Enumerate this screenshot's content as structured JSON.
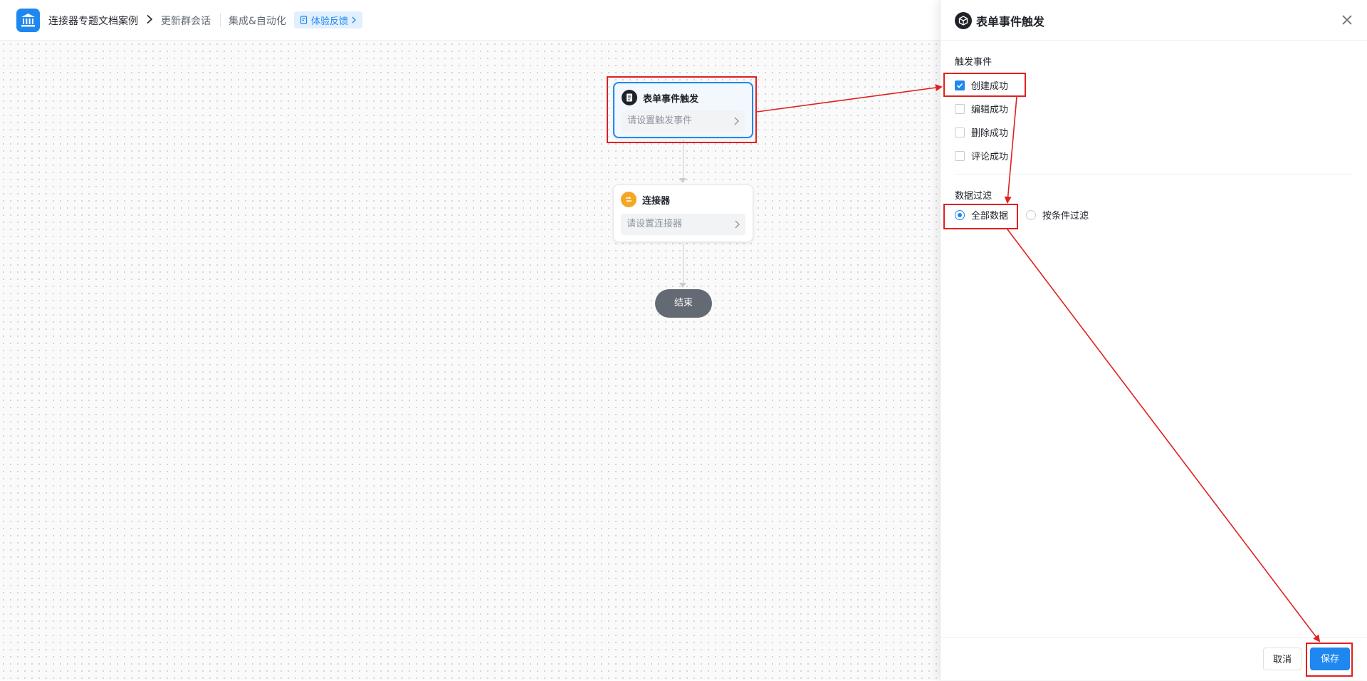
{
  "header": {
    "breadcrumbs": [
      "连接器专题文档案例",
      "更新群会话"
    ],
    "module": "集成&自动化",
    "feedback_label": "体验反馈"
  },
  "canvas": {
    "trigger_node": {
      "title": "表单事件触发",
      "placeholder": "请设置触发事件",
      "icon": "document-icon"
    },
    "connector_node": {
      "title": "连接器",
      "placeholder": "请设置连接器",
      "icon": "connector-icon"
    },
    "end_node": {
      "label": "结束"
    }
  },
  "panel": {
    "title": "表单事件触发",
    "trigger_section": {
      "label": "触发事件",
      "options": [
        {
          "label": "创建成功",
          "checked": true
        },
        {
          "label": "编辑成功",
          "checked": false
        },
        {
          "label": "删除成功",
          "checked": false
        },
        {
          "label": "评论成功",
          "checked": false
        }
      ]
    },
    "filter_section": {
      "label": "数据过滤",
      "options": [
        {
          "label": "全部数据",
          "selected": true
        },
        {
          "label": "按条件过滤",
          "selected": false
        }
      ]
    },
    "footer": {
      "cancel_label": "取消",
      "save_label": "保存"
    }
  },
  "colors": {
    "accent": "#1e88f0",
    "annotation": "#e02020",
    "connector_orange": "#f5a623",
    "end_node": "#646a73"
  }
}
